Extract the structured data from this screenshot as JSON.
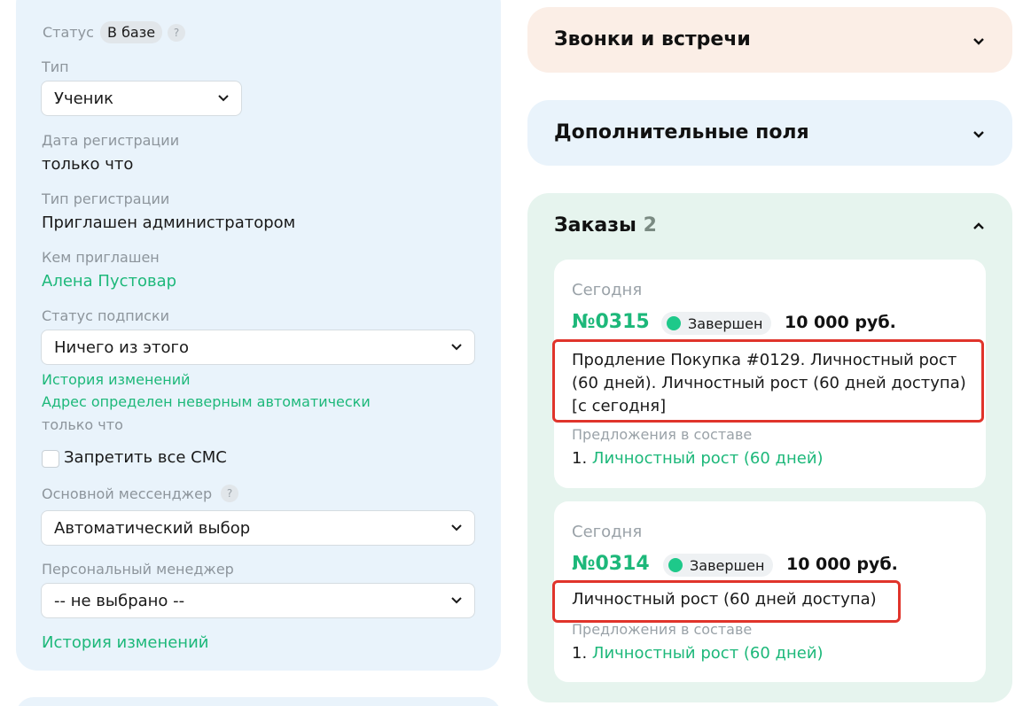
{
  "left": {
    "status_label": "Статус",
    "status_value": "В базе",
    "help": "?",
    "type_label": "Тип",
    "type_value": "Ученик",
    "reg_date_label": "Дата регистрации",
    "reg_date_value": "только что",
    "reg_type_label": "Тип регистрации",
    "reg_type_value": "Приглашен администратором",
    "invited_by_label": "Кем приглашен",
    "invited_by_value": "Алена Пустовар",
    "subscription_label": "Статус подписки",
    "subscription_value": "Ничего из этого",
    "history_link": "История изменений",
    "address_link": "Адрес определен неверным автоматически",
    "address_time": "только что",
    "sms_label": "Запретить все СМС",
    "messenger_label": "Основной мессенджер",
    "messenger_value": "Автоматический выбор",
    "manager_label": "Персональный менеджер",
    "manager_value": "-- не выбрано --",
    "history_link_bottom": "История изменений"
  },
  "right": {
    "calls_title": "Звонки и встречи",
    "calls_bg": "#fbeee6",
    "extra_title": "Дополнительные поля",
    "extra_bg": "#e9f3fb",
    "orders_title": "Заказы",
    "orders_count": "2",
    "orders_bg": "#e6f4ee",
    "orders": [
      {
        "date": "Сегодня",
        "number": "№0315",
        "status": "Завершен",
        "price": "10 000 руб.",
        "description": "Продление Покупка #0129. Личностный рост (60 дней). Личностный рост (60 дней доступа) [с сегодня]",
        "offers_label": "Предложения в составе",
        "offer_index": "1.",
        "offer_name": "Личностный рост (60 дней)"
      },
      {
        "date": "Сегодня",
        "number": "№0314",
        "status": "Завершен",
        "price": "10 000 руб.",
        "description": "Личностный рост (60 дней доступа)",
        "offers_label": "Предложения в составе",
        "offer_index": "1.",
        "offer_name": "Личностный рост (60 дней)"
      }
    ]
  },
  "colors": {
    "accent": "#1db87a",
    "highlight": "#e0342b"
  }
}
